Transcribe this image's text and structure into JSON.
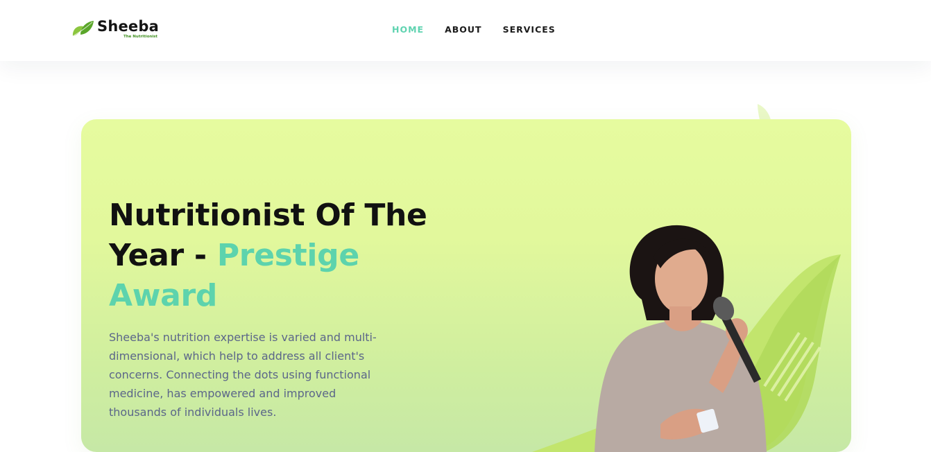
{
  "header": {
    "logo": {
      "name": "Sheeba",
      "tagline": "The Nutritionist",
      "icon": "leaf-icon",
      "leaf_color": "#7cc442"
    },
    "nav": [
      {
        "label": "HOME",
        "active": true
      },
      {
        "label": "ABOUT",
        "active": false
      },
      {
        "label": "SERVICES",
        "active": false
      }
    ]
  },
  "hero": {
    "title_line1": "Nutritionist Of The Year - ",
    "title_accent": "Prestige Award",
    "description": "Sheeba's nutrition expertise is varied and multi-dimensional, which help to address all client's concerns. Connecting the dots using functional medicine, has empowered and improved thousands of individuals lives.",
    "image": "speaker-photo",
    "colors": {
      "accent": "#5dd3ad",
      "background_top": "#e6fb9f",
      "background_bottom": "#c6e8a6",
      "text": "#5b6689"
    }
  }
}
